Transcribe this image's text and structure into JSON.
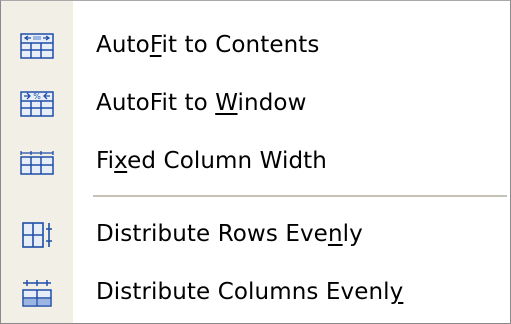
{
  "menu": {
    "items": [
      {
        "icon": "autofit-contents-icon",
        "pre": "Auto",
        "key": "F",
        "post": "it to Contents"
      },
      {
        "icon": "autofit-window-icon",
        "pre": "AutoFit to ",
        "key": "W",
        "post": "indow"
      },
      {
        "icon": "fixed-column-width-icon",
        "pre": "Fi",
        "key": "x",
        "post": "ed Column Width"
      },
      {
        "icon": "distribute-rows-icon",
        "pre": "Distribute Rows Eve",
        "key": "n",
        "post": "ly"
      },
      {
        "icon": "distribute-columns-icon",
        "pre": "Distribute Columns Evenl",
        "key": "y",
        "post": ""
      }
    ]
  },
  "colors": {
    "icon_blue": "#1f4fa8",
    "icon_light": "#9bb6e3",
    "gutter": "#f1efe6",
    "separator": "#c5c2b8"
  }
}
